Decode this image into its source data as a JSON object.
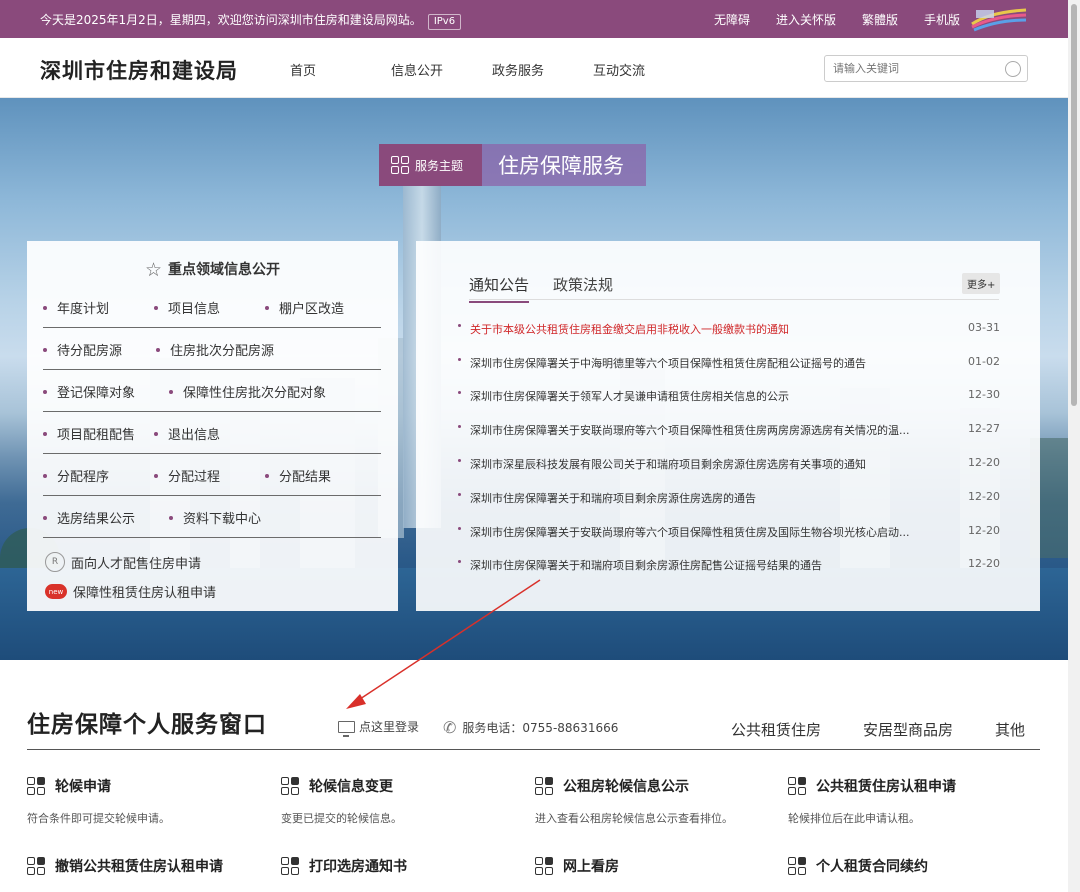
{
  "topbar": {
    "welcome": "今天是2025年1月2日，星期四，欢迎您访问深圳市住房和建设局网站。",
    "ipv6": "IPv6",
    "links": [
      "无障碍",
      "进入关怀版",
      "繁體版",
      "手机版"
    ]
  },
  "header": {
    "site_title": "深圳市住房和建设局",
    "nav": [
      "首页",
      "信息公开",
      "政务服务",
      "互动交流"
    ],
    "search_placeholder": "请输入关键词"
  },
  "hero": {
    "theme_label": "服务主题",
    "theme_title": "住房保障服务"
  },
  "key_info": {
    "title": "重点领域信息公开",
    "rows": [
      [
        "年度计划",
        "项目信息",
        "棚户区改造"
      ],
      [
        "待分配房源",
        "住房批次分配房源"
      ],
      [
        "登记保障对象",
        "保障性住房批次分配对象"
      ],
      [
        "项目配租配售",
        "退出信息"
      ],
      [
        "分配程序",
        "分配过程",
        "分配结果"
      ],
      [
        "选房结果公示",
        "资料下载中心"
      ]
    ],
    "special_links": [
      "面向人才配售住房申请",
      "保障性租赁住房认租申请"
    ],
    "new_badge": "new"
  },
  "news_panel": {
    "tabs": [
      "通知公告",
      "政策法规"
    ],
    "more": "更多+",
    "items": [
      {
        "title": "关于市本级公共租赁住房租金缴交启用非税收入一般缴款书的通知",
        "date": "03-31"
      },
      {
        "title": "深圳市住房保障署关于中海明德里等六个项目保障性租赁住房配租公证摇号的通告",
        "date": "01-02"
      },
      {
        "title": "深圳市住房保障署关于领军人才吴谦申请租赁住房相关信息的公示",
        "date": "12-30"
      },
      {
        "title": "深圳市住房保障署关于安联尚璟府等六个项目保障性租赁住房两房房源选房有关情况的温...",
        "date": "12-27"
      },
      {
        "title": "深圳市深星辰科技发展有限公司关于和瑞府项目剩余房源住房选房有关事项的通知",
        "date": "12-20"
      },
      {
        "title": "深圳市住房保障署关于和瑞府项目剩余房源住房选房的通告",
        "date": "12-20"
      },
      {
        "title": "深圳市住房保障署关于安联尚璟府等六个项目保障性租赁住房及国际生物谷坝光核心启动...",
        "date": "12-20"
      },
      {
        "title": "深圳市住房保障署关于和瑞府项目剩余房源住房配售公证摇号结果的通告",
        "date": "12-20"
      }
    ]
  },
  "service_window": {
    "title": "住房保障个人服务窗口",
    "login": "点这里登录",
    "phone": "服务电话：0755-88631666",
    "categories": [
      "公共租赁住房",
      "安居型商品房",
      "其他"
    ],
    "services": [
      {
        "name": "轮候申请",
        "desc": "符合条件即可提交轮候申请。"
      },
      {
        "name": "轮候信息变更",
        "desc": "变更已提交的轮候信息。"
      },
      {
        "name": "公租房轮候信息公示",
        "desc": "进入查看公租房轮候信息公示查看排位。"
      },
      {
        "name": "公共租赁住房认租申请",
        "desc": "轮候排位后在此申请认租。"
      },
      {
        "name": "撤销公共租赁住房认租申请",
        "desc": ""
      },
      {
        "name": "打印选房通知书",
        "desc": ""
      },
      {
        "name": "网上看房",
        "desc": ""
      },
      {
        "name": "个人租赁合同续约",
        "desc": ""
      }
    ]
  },
  "colors": {
    "brand": "#8a4a7c",
    "highlight_news": "#d0282a",
    "annotation_arrow": "#d9302a"
  }
}
